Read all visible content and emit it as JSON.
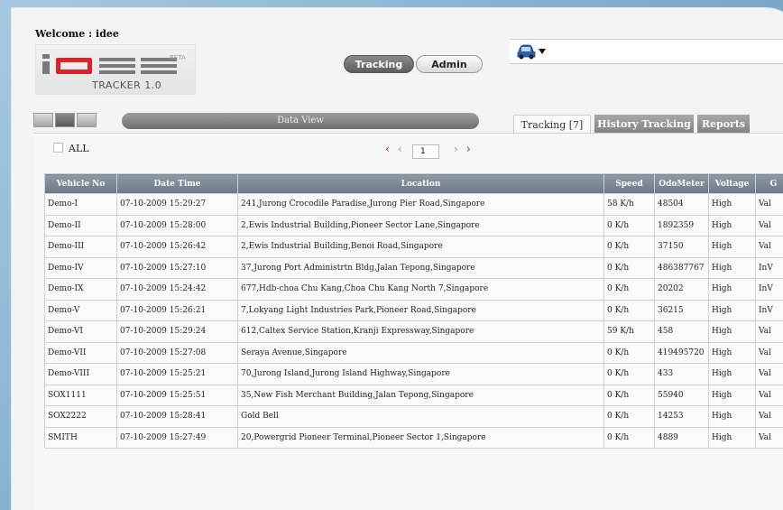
{
  "header": {
    "welcome": "Welcome : idee",
    "logo_text": "iDEE",
    "beta": "BETA",
    "tracker_version": "TRACKER 1.0"
  },
  "nav": {
    "tracking_label": "Tracking",
    "admin_label": "Admin",
    "vehicle_icon": "car-icon"
  },
  "toolbar": {
    "data_view_label": "Data View"
  },
  "tabs": [
    {
      "label": "Tracking [7]",
      "active": true
    },
    {
      "label": "History Tracking",
      "active": false
    },
    {
      "label": "Reports",
      "active": false
    }
  ],
  "filter": {
    "all_label": "ALL",
    "page_value": "1"
  },
  "table": {
    "columns": [
      "Vehicle No",
      "Date Time",
      "Location",
      "Speed",
      "OdoMeter",
      "Voltage",
      "G"
    ],
    "rows": [
      [
        "Demo-I",
        "07-10-2009 15:29:27",
        "241,Jurong Crocodile Paradise,Jurong Pier Road,Singapore",
        "58 K/h",
        "48504",
        "High",
        "Val"
      ],
      [
        "Demo-II",
        "07-10-2009 15:28:00",
        "2,Ewis Industrial Building,Pioneer Sector Lane,Singapore",
        "0 K/h",
        "1892359",
        "High",
        "Val"
      ],
      [
        "Demo-III",
        "07-10-2009 15:26:42",
        "2,Ewis Industrial Building,Benoi Road,Singapore",
        "0 K/h",
        "37150",
        "High",
        "Val"
      ],
      [
        "Demo-IV",
        "07-10-2009 15:27:10",
        "37,Jurong Port Administrtn Bldg,Jalan Tepong,Singapore",
        "0 K/h",
        "486387767",
        "High",
        "InV"
      ],
      [
        "Demo-IX",
        "07-10-2009 15:24:42",
        "677,Hdb-choa Chu Kang,Choa Chu Kang North 7,Singapore",
        "0 K/h",
        "20202",
        "High",
        "InV"
      ],
      [
        "Demo-V",
        "07-10-2009 15:26:21",
        "7,Lokyang Light Industries Park,Pioneer Road,Singapore",
        "0 K/h",
        "36215",
        "High",
        "InV"
      ],
      [
        "Demo-VI",
        "07-10-2009 15:29:24",
        "612,Caltex Service Station,Kranji Expressway,Singapore",
        "59 K/h",
        "458",
        "High",
        "Val"
      ],
      [
        "Demo-VII",
        "07-10-2009 15:27:08",
        "Seraya Avenue,Singapore",
        "0 K/h",
        "419495720",
        "High",
        "Val"
      ],
      [
        "Demo-VIII",
        "07-10-2009 15:25:21",
        "70,Jurong Island,Jurong Island Highway,Singapore",
        "0 K/h",
        "433",
        "High",
        "Val"
      ],
      [
        "SOX1111",
        "07-10-2009 15:25:51",
        "35,New Fish Merchant Building,Jalan Tepong,Singapore",
        "0 K/h",
        "55940",
        "High",
        "Val"
      ],
      [
        "SOX2222",
        "07-10-2009 15:28:41",
        "Gold Bell",
        "0 K/h",
        "14253",
        "High",
        "Val"
      ],
      [
        "SMITH",
        "07-10-2009 15:27:49",
        "20,Powergrid Pioneer Terminal,Pioneer Sector 1,Singapore",
        "0 K/h",
        "4889",
        "High",
        "Val"
      ]
    ]
  }
}
